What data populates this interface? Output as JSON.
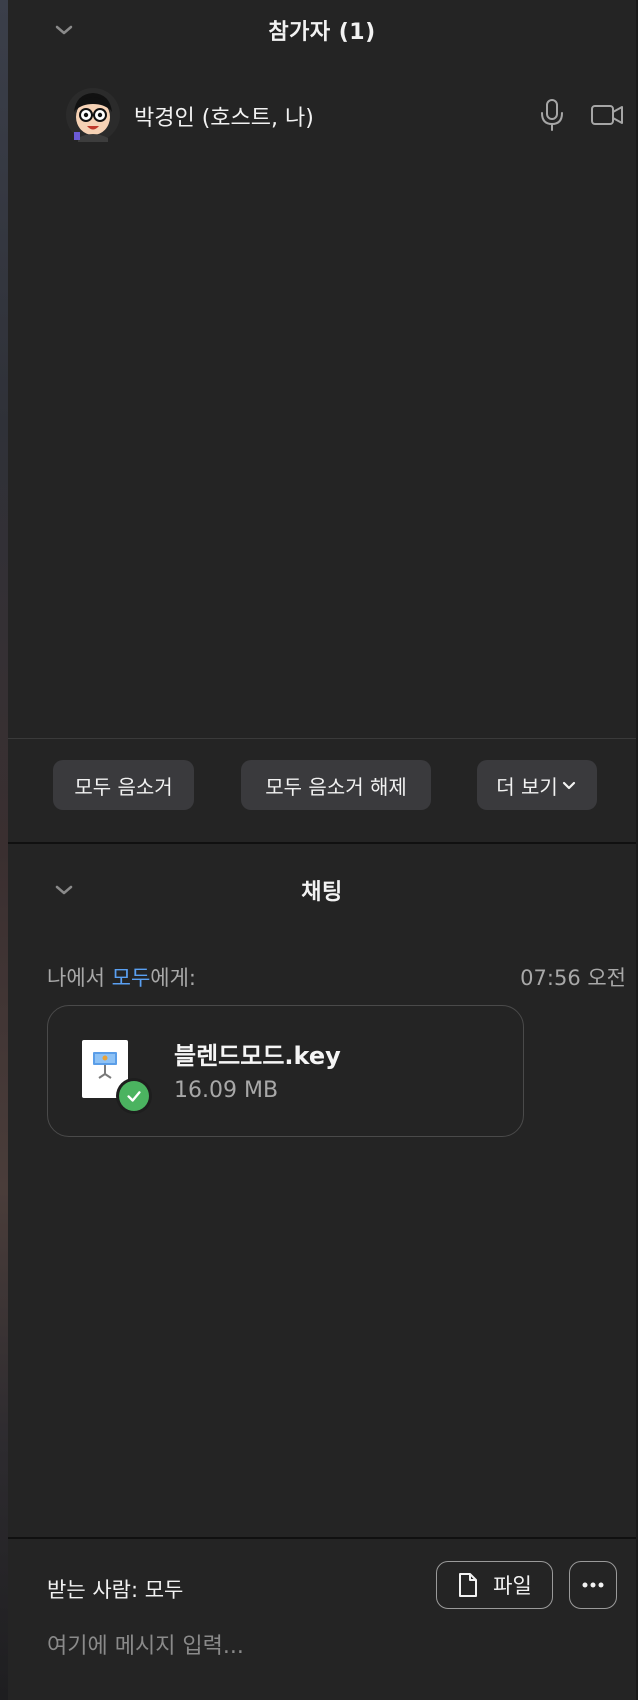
{
  "participants": {
    "header_title": "참가자 (1)",
    "list": [
      {
        "name": "박경인 (호스트, 나)",
        "mic_icon": "microphone-icon",
        "video_icon": "video-camera-icon"
      }
    ],
    "buttons": {
      "mute_all": "모두 음소거",
      "unmute_all": "모두 음소거 해제",
      "more": "더 보기"
    }
  },
  "chat": {
    "header_title": "채팅",
    "messages": [
      {
        "from": "나에서 ",
        "to": "모두",
        "suffix": "에게:",
        "time": "07:56 오전",
        "attachment": {
          "file_name": "블렌드모드.key",
          "file_size": "16.09 MB",
          "icon": "keynote-file-icon",
          "status_icon": "check-circle-icon"
        }
      }
    ],
    "composer": {
      "recipient_label": "받는 사람: 모두",
      "file_button": "파일",
      "more_icon": "ellipsis-icon",
      "placeholder": "여기에 메시지 입력..."
    }
  },
  "colors": {
    "background": "#242424",
    "button_bg": "#3a3a3d",
    "link_blue": "#5aa0f2",
    "success_green": "#4bb360"
  }
}
